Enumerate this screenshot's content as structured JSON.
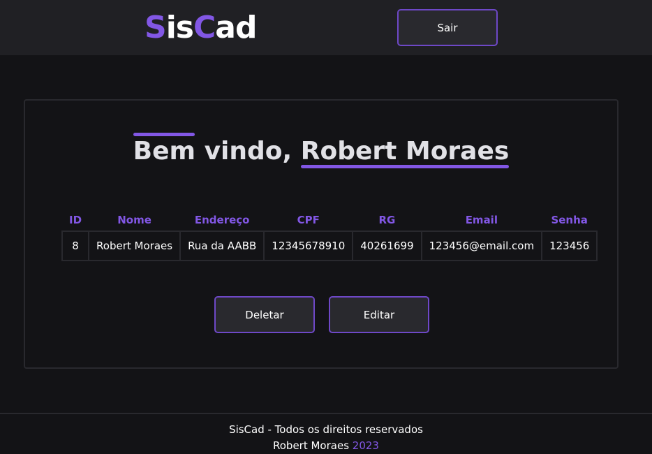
{
  "header": {
    "logo": {
      "part1": "S",
      "part2": "is",
      "part3": "C",
      "part4": "ad"
    },
    "logout_label": "Sair"
  },
  "main": {
    "welcome_prefix": "Bem vindo,",
    "user_name": "Robert Moraes",
    "table": {
      "columns": [
        "ID",
        "Nome",
        "Endereço",
        "CPF",
        "RG",
        "Email",
        "Senha"
      ],
      "rows": [
        [
          "8",
          "Robert Moraes",
          "Rua da AABB",
          "12345678910",
          "40261699",
          "123456@email.com",
          "123456"
        ]
      ]
    },
    "delete_label": "Deletar",
    "edit_label": "Editar"
  },
  "footer": {
    "line1": "SisCad - Todos os direitos reservados",
    "author": "Robert Moraes",
    "year": "2023"
  },
  "colors": {
    "accent": "#8257e5",
    "background": "#131316",
    "surface": "#202024"
  }
}
